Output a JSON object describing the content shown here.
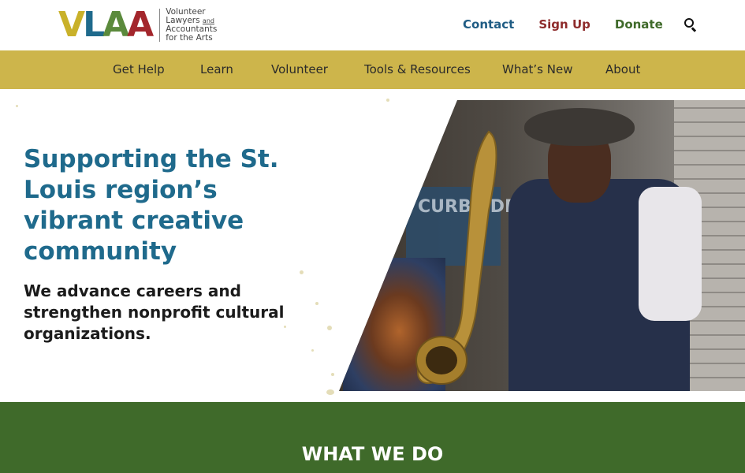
{
  "logo": {
    "letters": [
      "V",
      "L",
      "A",
      "A"
    ],
    "tagline": [
      "Volunteer",
      "Lawyers",
      "and",
      "Accountants",
      "for the Arts"
    ]
  },
  "topnav": {
    "contact": "Contact",
    "signup": "Sign Up",
    "donate": "Donate",
    "search_icon": "search-icon"
  },
  "mainnav": {
    "items": [
      "Get Help",
      "Learn",
      "Volunteer",
      "Tools & Resources",
      "What’s New",
      "About"
    ]
  },
  "hero": {
    "title": "Supporting the St. Louis region’s vibrant creative community",
    "subtitle": "We advance careers and strengthen nonprofit cultural organizations.",
    "photo_sign_text": "CURBSIDE SERVICE"
  },
  "section": {
    "heading": "WHAT WE DO"
  },
  "colors": {
    "nav_bar": "#cdb54b",
    "brand_blue": "#1f6a8c",
    "signup_red": "#8e2b2b",
    "donate_green": "#3f6a2a",
    "section_green": "#3f6a2a"
  }
}
